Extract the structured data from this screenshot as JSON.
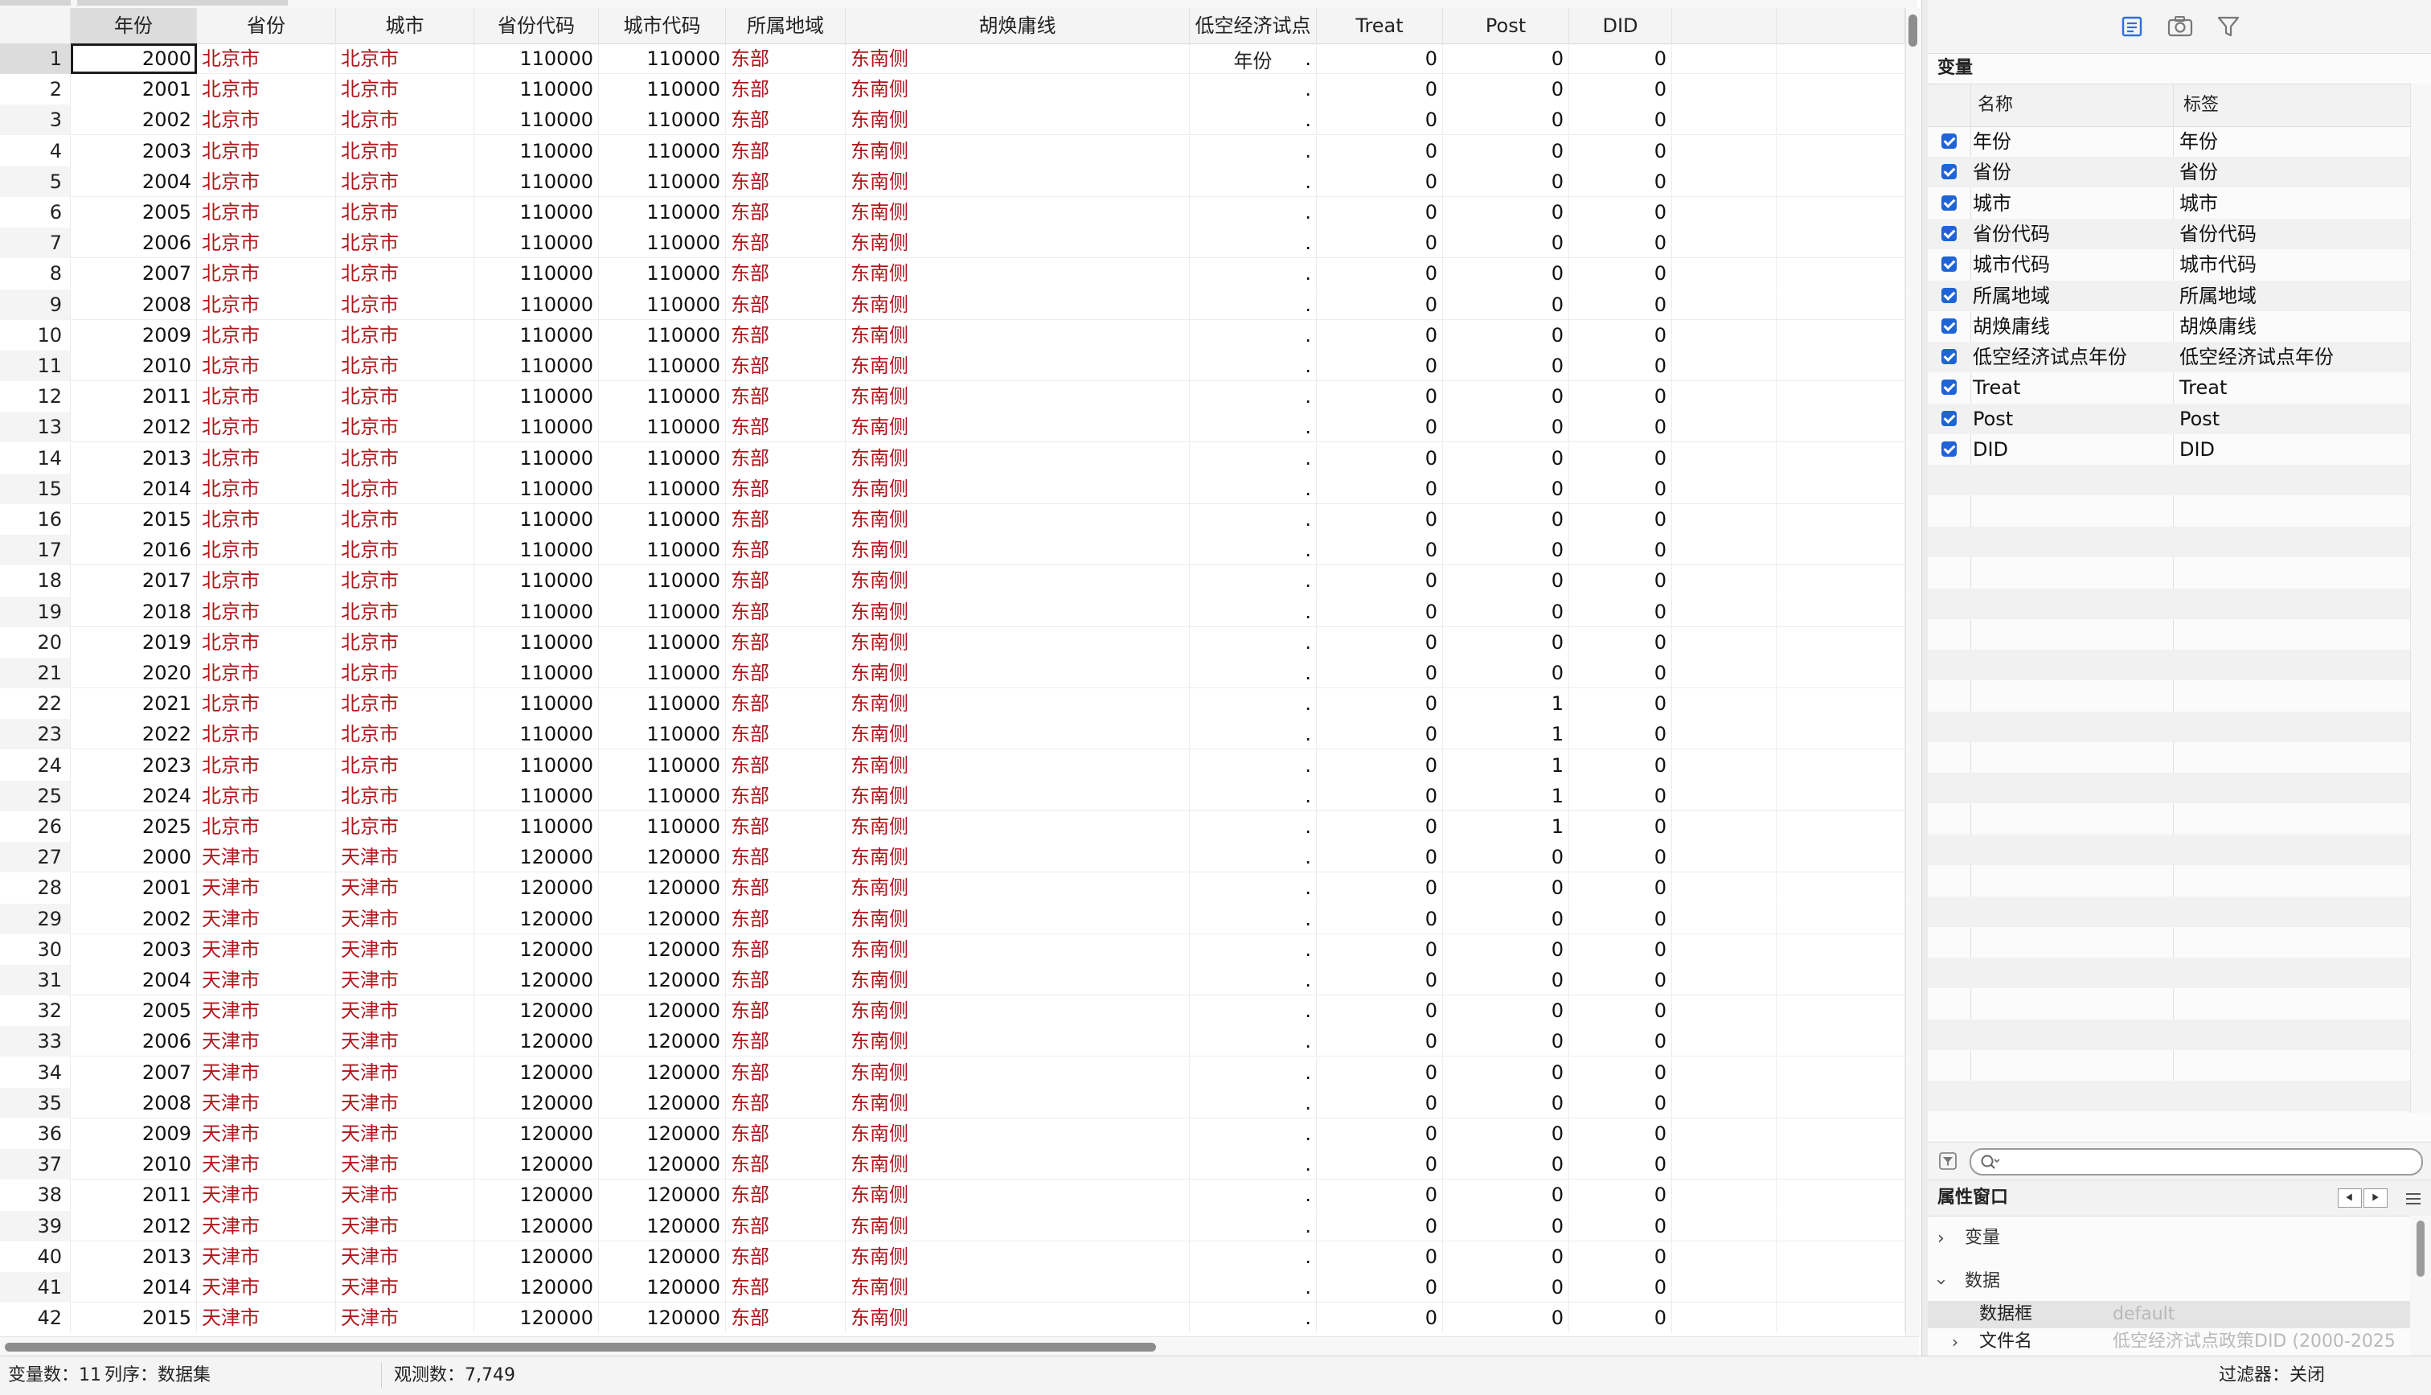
{
  "grid": {
    "columns": [
      "年份",
      "省份",
      "城市",
      "省份代码",
      "城市代码",
      "所属地域",
      "胡焕庸线",
      "低空经济试点年份",
      "Treat",
      "Post",
      "DID"
    ],
    "rows": [
      [
        1,
        2000,
        "北京市",
        "北京市",
        110000,
        110000,
        "东部",
        "东南侧",
        ".",
        0,
        0,
        0
      ],
      [
        2,
        2001,
        "北京市",
        "北京市",
        110000,
        110000,
        "东部",
        "东南侧",
        ".",
        0,
        0,
        0
      ],
      [
        3,
        2002,
        "北京市",
        "北京市",
        110000,
        110000,
        "东部",
        "东南侧",
        ".",
        0,
        0,
        0
      ],
      [
        4,
        2003,
        "北京市",
        "北京市",
        110000,
        110000,
        "东部",
        "东南侧",
        ".",
        0,
        0,
        0
      ],
      [
        5,
        2004,
        "北京市",
        "北京市",
        110000,
        110000,
        "东部",
        "东南侧",
        ".",
        0,
        0,
        0
      ],
      [
        6,
        2005,
        "北京市",
        "北京市",
        110000,
        110000,
        "东部",
        "东南侧",
        ".",
        0,
        0,
        0
      ],
      [
        7,
        2006,
        "北京市",
        "北京市",
        110000,
        110000,
        "东部",
        "东南侧",
        ".",
        0,
        0,
        0
      ],
      [
        8,
        2007,
        "北京市",
        "北京市",
        110000,
        110000,
        "东部",
        "东南侧",
        ".",
        0,
        0,
        0
      ],
      [
        9,
        2008,
        "北京市",
        "北京市",
        110000,
        110000,
        "东部",
        "东南侧",
        ".",
        0,
        0,
        0
      ],
      [
        10,
        2009,
        "北京市",
        "北京市",
        110000,
        110000,
        "东部",
        "东南侧",
        ".",
        0,
        0,
        0
      ],
      [
        11,
        2010,
        "北京市",
        "北京市",
        110000,
        110000,
        "东部",
        "东南侧",
        ".",
        0,
        0,
        0
      ],
      [
        12,
        2011,
        "北京市",
        "北京市",
        110000,
        110000,
        "东部",
        "东南侧",
        ".",
        0,
        0,
        0
      ],
      [
        13,
        2012,
        "北京市",
        "北京市",
        110000,
        110000,
        "东部",
        "东南侧",
        ".",
        0,
        0,
        0
      ],
      [
        14,
        2013,
        "北京市",
        "北京市",
        110000,
        110000,
        "东部",
        "东南侧",
        ".",
        0,
        0,
        0
      ],
      [
        15,
        2014,
        "北京市",
        "北京市",
        110000,
        110000,
        "东部",
        "东南侧",
        ".",
        0,
        0,
        0
      ],
      [
        16,
        2015,
        "北京市",
        "北京市",
        110000,
        110000,
        "东部",
        "东南侧",
        ".",
        0,
        0,
        0
      ],
      [
        17,
        2016,
        "北京市",
        "北京市",
        110000,
        110000,
        "东部",
        "东南侧",
        ".",
        0,
        0,
        0
      ],
      [
        18,
        2017,
        "北京市",
        "北京市",
        110000,
        110000,
        "东部",
        "东南侧",
        ".",
        0,
        0,
        0
      ],
      [
        19,
        2018,
        "北京市",
        "北京市",
        110000,
        110000,
        "东部",
        "东南侧",
        ".",
        0,
        0,
        0
      ],
      [
        20,
        2019,
        "北京市",
        "北京市",
        110000,
        110000,
        "东部",
        "东南侧",
        ".",
        0,
        0,
        0
      ],
      [
        21,
        2020,
        "北京市",
        "北京市",
        110000,
        110000,
        "东部",
        "东南侧",
        ".",
        0,
        0,
        0
      ],
      [
        22,
        2021,
        "北京市",
        "北京市",
        110000,
        110000,
        "东部",
        "东南侧",
        ".",
        0,
        1,
        0
      ],
      [
        23,
        2022,
        "北京市",
        "北京市",
        110000,
        110000,
        "东部",
        "东南侧",
        ".",
        0,
        1,
        0
      ],
      [
        24,
        2023,
        "北京市",
        "北京市",
        110000,
        110000,
        "东部",
        "东南侧",
        ".",
        0,
        1,
        0
      ],
      [
        25,
        2024,
        "北京市",
        "北京市",
        110000,
        110000,
        "东部",
        "东南侧",
        ".",
        0,
        1,
        0
      ],
      [
        26,
        2025,
        "北京市",
        "北京市",
        110000,
        110000,
        "东部",
        "东南侧",
        ".",
        0,
        1,
        0
      ],
      [
        27,
        2000,
        "天津市",
        "天津市",
        120000,
        120000,
        "东部",
        "东南侧",
        ".",
        0,
        0,
        0
      ],
      [
        28,
        2001,
        "天津市",
        "天津市",
        120000,
        120000,
        "东部",
        "东南侧",
        ".",
        0,
        0,
        0
      ],
      [
        29,
        2002,
        "天津市",
        "天津市",
        120000,
        120000,
        "东部",
        "东南侧",
        ".",
        0,
        0,
        0
      ],
      [
        30,
        2003,
        "天津市",
        "天津市",
        120000,
        120000,
        "东部",
        "东南侧",
        ".",
        0,
        0,
        0
      ],
      [
        31,
        2004,
        "天津市",
        "天津市",
        120000,
        120000,
        "东部",
        "东南侧",
        ".",
        0,
        0,
        0
      ],
      [
        32,
        2005,
        "天津市",
        "天津市",
        120000,
        120000,
        "东部",
        "东南侧",
        ".",
        0,
        0,
        0
      ],
      [
        33,
        2006,
        "天津市",
        "天津市",
        120000,
        120000,
        "东部",
        "东南侧",
        ".",
        0,
        0,
        0
      ],
      [
        34,
        2007,
        "天津市",
        "天津市",
        120000,
        120000,
        "东部",
        "东南侧",
        ".",
        0,
        0,
        0
      ],
      [
        35,
        2008,
        "天津市",
        "天津市",
        120000,
        120000,
        "东部",
        "东南侧",
        ".",
        0,
        0,
        0
      ],
      [
        36,
        2009,
        "天津市",
        "天津市",
        120000,
        120000,
        "东部",
        "东南侧",
        ".",
        0,
        0,
        0
      ],
      [
        37,
        2010,
        "天津市",
        "天津市",
        120000,
        120000,
        "东部",
        "东南侧",
        ".",
        0,
        0,
        0
      ],
      [
        38,
        2011,
        "天津市",
        "天津市",
        120000,
        120000,
        "东部",
        "东南侧",
        ".",
        0,
        0,
        0
      ],
      [
        39,
        2012,
        "天津市",
        "天津市",
        120000,
        120000,
        "东部",
        "东南侧",
        ".",
        0,
        0,
        0
      ],
      [
        40,
        2013,
        "天津市",
        "天津市",
        120000,
        120000,
        "东部",
        "东南侧",
        ".",
        0,
        0,
        0
      ],
      [
        41,
        2014,
        "天津市",
        "天津市",
        120000,
        120000,
        "东部",
        "东南侧",
        ".",
        0,
        0,
        0
      ],
      [
        42,
        2015,
        "天津市",
        "天津市",
        120000,
        120000,
        "东部",
        "东南侧",
        ".",
        0,
        0,
        0
      ]
    ]
  },
  "variables_panel": {
    "title": "变量",
    "col_name": "名称",
    "col_label": "标签",
    "items": [
      {
        "name": "年份",
        "label": "年份"
      },
      {
        "name": "省份",
        "label": "省份"
      },
      {
        "name": "城市",
        "label": "城市"
      },
      {
        "name": "省份代码",
        "label": "省份代码"
      },
      {
        "name": "城市代码",
        "label": "城市代码"
      },
      {
        "name": "所属地域",
        "label": "所属地域"
      },
      {
        "name": "胡焕庸线",
        "label": "胡焕庸线"
      },
      {
        "name": "低空经济试点年份",
        "label": "低空经济试点年份"
      },
      {
        "name": "Treat",
        "label": "Treat"
      },
      {
        "name": "Post",
        "label": "Post"
      },
      {
        "name": "DID",
        "label": "DID"
      }
    ]
  },
  "properties": {
    "title": "属性窗口",
    "variables_node": "变量",
    "data_node": "数据",
    "frame_key": "数据框",
    "frame_value": "default",
    "filename_key": "文件名",
    "filename_value": "低空经济试点政策DID (2000-2025"
  },
  "status": {
    "var_count": "变量数：11",
    "sort": "列序：数据集",
    "obs": "观测数：7,749",
    "filter": "过滤器：关闭"
  },
  "colors": {
    "string_text": "#b0171c",
    "checkbox": "#1f64d6"
  },
  "icons": [
    "variables-icon",
    "snapshot-icon",
    "filter-icon",
    "search-icon"
  ]
}
